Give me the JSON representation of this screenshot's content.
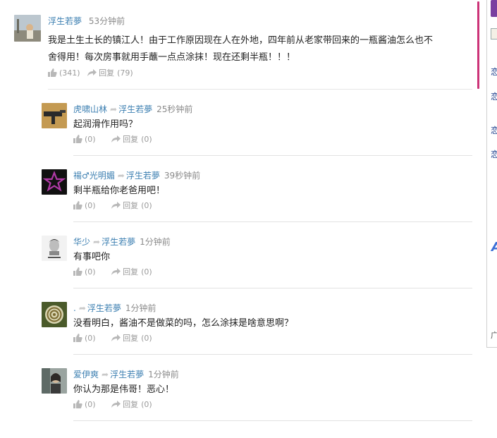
{
  "thread": {
    "main": {
      "user": "浮生若夢",
      "time": "53分钟前",
      "text_line1": "我是土生土长的镇江人！由于工作原因现在人在外地，四年前从老家带回来的一瓶酱油怎么也不",
      "text_line2": "舍得用！每次房事就用手蘸一点点涂抹！现在还剩半瓶！！！",
      "likes": "(341)",
      "reply_label": "回复",
      "reply_count": "(79)"
    },
    "replies": [
      {
        "user": "虎啸山林",
        "target": "浮生若夢",
        "time": "25秒钟前",
        "text": "起润滑作用吗？",
        "likes": "(0)",
        "reply_label": "回复",
        "reply_count": "(0)"
      },
      {
        "user": "禓♂光明媚",
        "target": "浮生若夢",
        "time": "39秒钟前",
        "text": "剩半瓶给你老爸用吧！",
        "likes": "(0)",
        "reply_label": "回复",
        "reply_count": "(0)"
      },
      {
        "user": "华少",
        "target": "浮生若夢",
        "time": "1分钟前",
        "text": "有事吧你",
        "likes": "(0)",
        "reply_label": "回复",
        "reply_count": "(0)"
      },
      {
        "user": ".",
        "target": "浮生若夢",
        "time": "1分钟前",
        "text": "没看明白，酱油不是做菜的吗，怎么涂抹是啥意思啊？",
        "likes": "(0)",
        "reply_label": "回复",
        "reply_count": "(0)"
      },
      {
        "user": "爱伊爽",
        "target": "浮生若夢",
        "time": "1分钟前",
        "text": "你认为那是伟哥！恶心！",
        "likes": "(0)",
        "reply_label": "回复",
        "reply_count": "(0)"
      }
    ]
  },
  "sidebar": {
    "chars": [
      "恋",
      "恋",
      "恋",
      "恋"
    ],
    "letter": "A",
    "bottom_char": "广"
  },
  "colors": {
    "username": "#3c7fb1",
    "time": "#8a8a8a",
    "accent_bar": "#cc3377"
  }
}
